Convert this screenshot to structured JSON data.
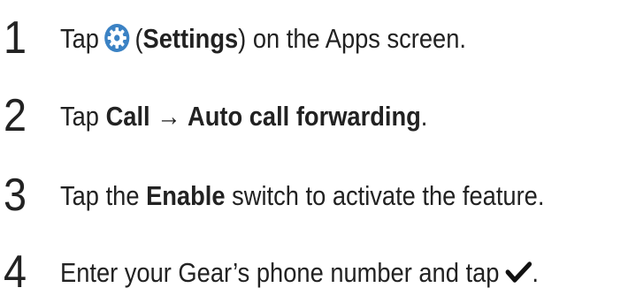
{
  "steps": [
    {
      "number": "1",
      "pre": "Tap",
      "icon": "settings-gear-icon",
      "paren_open": "(",
      "bold1": "Settings",
      "post": ") on the Apps screen."
    },
    {
      "number": "2",
      "pre": "Tap ",
      "bold1": "Call",
      "arrow": " → ",
      "bold2": "Auto call forwarding",
      "post": "."
    },
    {
      "number": "3",
      "pre": "Tap the ",
      "bold1": "Enable",
      "post": " switch to activate the feature."
    },
    {
      "number": "4",
      "pre": "Enter your Gear’s phone number and tap",
      "icon": "checkmark-icon",
      "post": "."
    }
  ],
  "colors": {
    "text": "#222222",
    "gear_icon": "#3b82c4"
  }
}
